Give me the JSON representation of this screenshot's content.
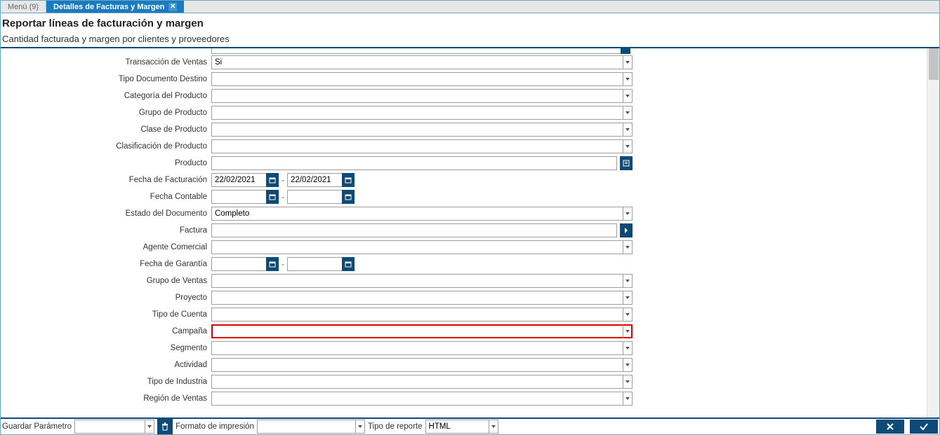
{
  "tabs": {
    "menu": "Menú (9)",
    "active": "Detalles de Facturas y Margen"
  },
  "header": {
    "title": "Reportar líneas de facturación y margen",
    "subtitle": "Cantidad facturada y margen por clientes y proveedores"
  },
  "form": {
    "transaccion_ventas": {
      "label": "Transacción de Ventas",
      "value": "Si"
    },
    "tipo_documento_destino": {
      "label": "Tipo Documento Destino",
      "value": ""
    },
    "categoria_producto": {
      "label": "Categoría del Producto",
      "value": ""
    },
    "grupo_producto": {
      "label": "Grupo de Producto",
      "value": ""
    },
    "clase_producto": {
      "label": "Clase de Producto",
      "value": ""
    },
    "clasificacion_producto": {
      "label": "Clasificación de Producto",
      "value": ""
    },
    "producto": {
      "label": "Producto",
      "value": ""
    },
    "fecha_facturacion": {
      "label": "Fecha de Facturación",
      "from": "22/02/2021",
      "to": "22/02/2021"
    },
    "fecha_contable": {
      "label": "Fecha Contable",
      "from": "",
      "to": ""
    },
    "estado_documento": {
      "label": "Estado del Documento",
      "value": "Completo"
    },
    "factura": {
      "label": "Factura",
      "value": ""
    },
    "agente_comercial": {
      "label": "Agente Comercial",
      "value": ""
    },
    "fecha_garantia": {
      "label": "Fecha de Garantía",
      "from": "",
      "to": ""
    },
    "grupo_ventas": {
      "label": "Grupo de Ventas",
      "value": ""
    },
    "proyecto": {
      "label": "Proyecto",
      "value": ""
    },
    "tipo_cuenta": {
      "label": "Tipo de Cuenta",
      "value": ""
    },
    "campana": {
      "label": "Campaña",
      "value": ""
    },
    "segmento": {
      "label": "Segmento",
      "value": ""
    },
    "actividad": {
      "label": "Actividad",
      "value": ""
    },
    "tipo_industria": {
      "label": "Tipo de Industria",
      "value": ""
    },
    "region_ventas": {
      "label": "Región de Ventas",
      "value": ""
    }
  },
  "footer": {
    "guardar_parametro": {
      "label": "Guardar Parámetro",
      "value": ""
    },
    "formato_impresion": {
      "label": "Formato de impresión",
      "value": ""
    },
    "tipo_reporte": {
      "label": "Tipo de reporte",
      "value": "HTML"
    }
  }
}
